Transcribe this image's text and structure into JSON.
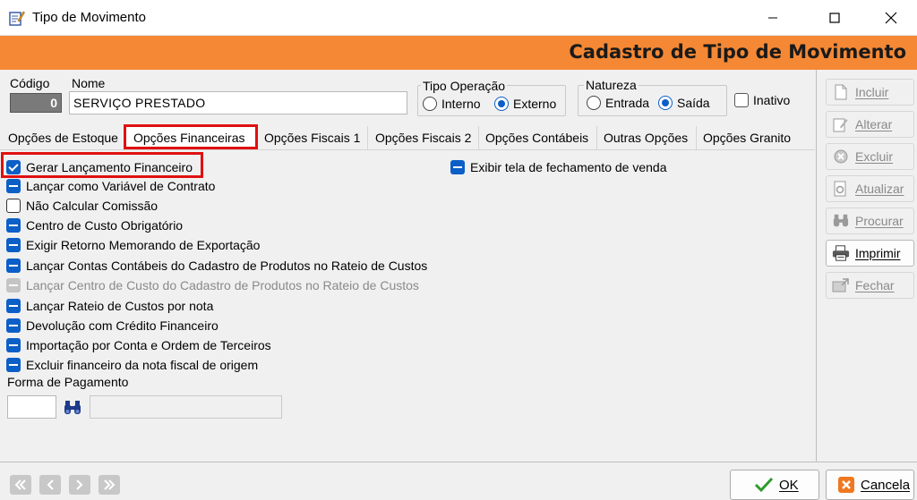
{
  "window": {
    "title": "Tipo de Movimento",
    "minimize_icon": "minimize-icon",
    "maximize_icon": "maximize-icon",
    "close_icon": "close-icon"
  },
  "header": {
    "title": "Cadastro de Tipo de Movimento",
    "color": "#f58834"
  },
  "form": {
    "codigo_label": "Código",
    "codigo_value": "0",
    "nome_label": "Nome",
    "nome_value": "SERVIÇO PRESTADO",
    "tipo_operacao": {
      "label": "Tipo Operação",
      "options": [
        "Interno",
        "Externo"
      ],
      "selected": "Externo"
    },
    "natureza": {
      "label": "Natureza",
      "options": [
        "Entrada",
        "Saída"
      ],
      "selected": "Saída"
    },
    "inativo_label": "Inativo",
    "inativo_checked": false
  },
  "tabs": [
    {
      "label": "Opções de Estoque",
      "active": false
    },
    {
      "label": "Opções Financeiras",
      "active": true
    },
    {
      "label": "Opções Fiscais 1",
      "active": false
    },
    {
      "label": "Opções Fiscais 2",
      "active": false
    },
    {
      "label": "Opções Contábeis",
      "active": false
    },
    {
      "label": "Outras Opções",
      "active": false
    },
    {
      "label": "Opções Granito",
      "active": false
    }
  ],
  "options": [
    {
      "label": "Gerar Lançamento Financeiro",
      "state": "checked"
    },
    {
      "label": "Lançar como Variável de Contrato",
      "state": "mixed"
    },
    {
      "label": "Não Calcular Comissão",
      "state": "unchecked"
    },
    {
      "label": "Centro de Custo Obrigatório",
      "state": "mixed"
    },
    {
      "label": "Exigir Retorno Memorando de Exportação",
      "state": "mixed"
    },
    {
      "label": "Lançar Contas Contábeis do Cadastro de Produtos no Rateio de Custos",
      "state": "mixed"
    },
    {
      "label": "Lançar Centro de Custo do Cadastro de Produtos no Rateio de Custos",
      "state": "disabled"
    },
    {
      "label": "Lançar Rateio de Custos  por nota",
      "state": "mixed"
    },
    {
      "label": "Devolução com Crédito Financeiro",
      "state": "mixed"
    },
    {
      "label": "Importação por Conta e Ordem de Terceiros",
      "state": "mixed"
    },
    {
      "label": "Excluir financeiro da nota fiscal de origem",
      "state": "mixed"
    }
  ],
  "right_option": {
    "label": "Exibir tela de fechamento de venda",
    "state": "mixed"
  },
  "forma_pagamento": {
    "label": "Forma de Pagamento",
    "code_value": "",
    "description_value": "",
    "search_icon": "binoculars-icon"
  },
  "sidebar": {
    "buttons": [
      {
        "label": "Incluir",
        "icon": "document-icon",
        "enabled": false
      },
      {
        "label": "Alterar",
        "icon": "edit-icon",
        "enabled": false
      },
      {
        "label": "Excluir",
        "icon": "trash-icon",
        "enabled": false
      },
      {
        "label": "Atualizar",
        "icon": "refresh-icon",
        "enabled": false
      },
      {
        "label": "Procurar",
        "icon": "binoculars-icon",
        "enabled": false
      },
      {
        "label": "Imprimir",
        "icon": "printer-icon",
        "enabled": true
      },
      {
        "label": "Fechar",
        "icon": "exit-icon",
        "enabled": false
      }
    ]
  },
  "footer": {
    "nav": [
      "first-icon",
      "prev-icon",
      "next-icon",
      "last-icon"
    ],
    "ok_label": "OK",
    "cancel_label": "Cancela"
  },
  "colors": {
    "accent": "#0b5fc7",
    "highlight": "#e01010",
    "header": "#f58834"
  }
}
